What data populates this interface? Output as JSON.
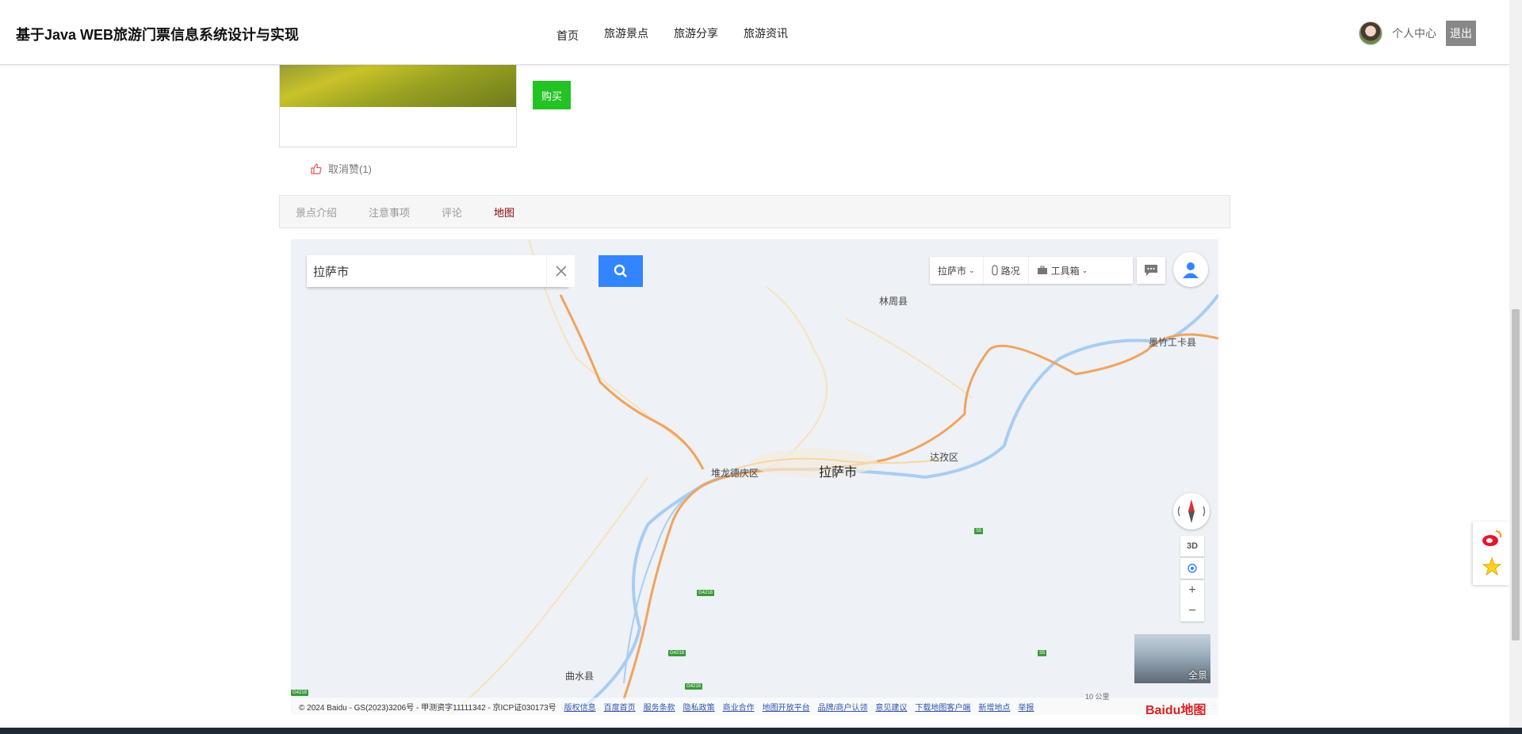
{
  "header": {
    "site_title": "基于Java WEB旅游门票信息系统设计与实现",
    "nav": [
      "首页",
      "旅游景点",
      "旅游分享",
      "旅游资讯"
    ],
    "user_center": "个人中心",
    "logout": "退出"
  },
  "ticket": {
    "buy_label": "购买"
  },
  "like": {
    "label": "取消赞(1)"
  },
  "tabs": [
    "景点介绍",
    "注意事项",
    "评论",
    "地图"
  ],
  "active_tab": "地图",
  "map": {
    "search_value": "拉萨市",
    "toolbar": {
      "city": "拉萨市",
      "traffic": "路况",
      "toolbox": "工具箱"
    },
    "three_d": "3D",
    "zoom_in": "+",
    "zoom_out": "−",
    "panorama_label": "全景",
    "place_labels": {
      "linzhou": "林周县",
      "mozhugongka": "墨竹工卡县",
      "duilongdeqing": "堆龙德庆区",
      "lhasa": "拉萨市",
      "dazi": "达孜区",
      "qushui": "曲水县"
    },
    "road_badges": [
      "G4218",
      "G4218",
      "G4218",
      "S5",
      "S5",
      "G4218"
    ],
    "copyright": "© 2024 Baidu - GS(2023)3206号 - 甲测资字11111342 - 京ICP证030173号",
    "footer_links": [
      "版权信息",
      "百度首页",
      "服务条款",
      "隐私政策",
      "商业合作",
      "地图开放平台",
      "品牌/商户认领",
      "意见建议",
      "下载地图客户端",
      "新增地点",
      "举报"
    ],
    "scale": "10 公里",
    "logo": "Baidu地图"
  },
  "colors": {
    "buy_button": "#22c322",
    "active_tab": "#8b0000",
    "search_button": "#3385ff",
    "logout_button": "#888888",
    "road_main": "#f0a35e",
    "water": "#a7cdf2"
  }
}
